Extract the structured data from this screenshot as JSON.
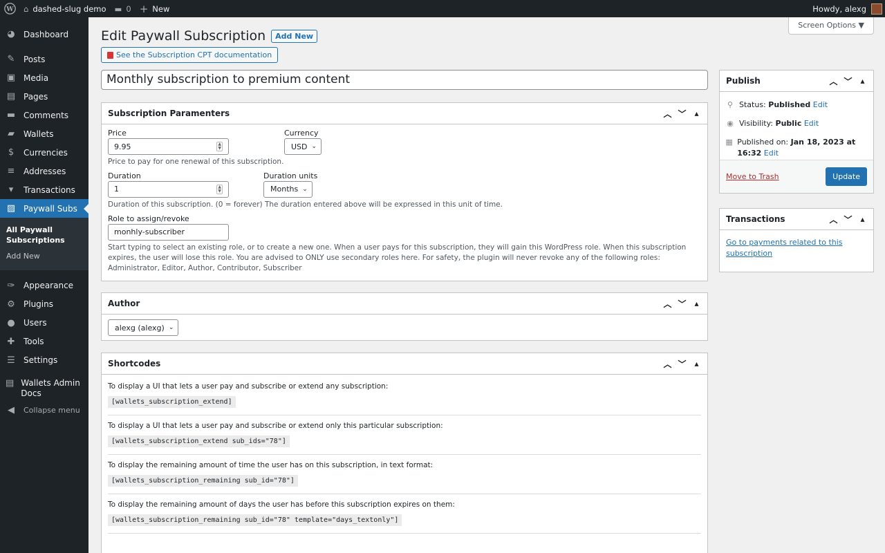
{
  "adminbar": {
    "site_name": "dashed-slug demo",
    "comments_count": "0",
    "new_label": "New",
    "howdy": "Howdy, alexg"
  },
  "sidebar": {
    "items_top": [
      {
        "label": "Dashboard",
        "icon": "dashboard-icon",
        "glyph": "◕"
      }
    ],
    "items_main": [
      {
        "label": "Posts",
        "icon": "pin-icon",
        "glyph": "✎"
      },
      {
        "label": "Media",
        "icon": "media-icon",
        "glyph": "▣"
      },
      {
        "label": "Pages",
        "icon": "page-icon",
        "glyph": "▤"
      },
      {
        "label": "Comments",
        "icon": "comment-icon",
        "glyph": "▬"
      },
      {
        "label": "Wallets",
        "icon": "wallet-icon",
        "glyph": "▰"
      },
      {
        "label": "Currencies",
        "icon": "currency-icon",
        "glyph": "$"
      },
      {
        "label": "Addresses",
        "icon": "addresses-icon",
        "glyph": "≡"
      },
      {
        "label": "Transactions",
        "icon": "transactions-icon",
        "glyph": "▾"
      }
    ],
    "current": {
      "label": "Paywall Subs",
      "icon": "paywall-icon",
      "glyph": "▨"
    },
    "submenu": [
      "All Paywall Subscriptions",
      "Add New"
    ],
    "items_bottom": [
      {
        "label": "Appearance",
        "icon": "appearance-icon",
        "glyph": "✑"
      },
      {
        "label": "Plugins",
        "icon": "plugin-icon",
        "glyph": "⚙"
      },
      {
        "label": "Users",
        "icon": "users-icon",
        "glyph": "●"
      },
      {
        "label": "Tools",
        "icon": "tools-icon",
        "glyph": "✚"
      },
      {
        "label": "Settings",
        "icon": "settings-icon",
        "glyph": "☰"
      }
    ],
    "wallets_docs": "Wallets Admin Docs",
    "collapse": "Collapse menu"
  },
  "header": {
    "screen_options": "Screen Options ▼",
    "title": "Edit Paywall Subscription",
    "add_new": "Add New",
    "doc_link": "See the Subscription CPT documentation"
  },
  "post_title": "Monthly subscription to premium content",
  "params": {
    "heading": "Subscription Paramenters",
    "price_label": "Price",
    "price_value": "9.95",
    "currency_label": "Currency",
    "currency_value": "USD",
    "price_desc": "Price to pay for one renewal of this subscription.",
    "duration_label": "Duration",
    "duration_value": "1",
    "duration_units_label": "Duration units",
    "duration_units_value": "Months",
    "duration_desc": "Duration of this subscription. (0 = forever) The duration entered above will be expressed in this unit of time.",
    "role_label": "Role to assign/revoke",
    "role_value": "monhly-subscriber",
    "role_desc": "Start typing to select an existing role, or to create a new one. When a user pays for this subscription, they will gain this WordPress role. When this subscription expires, the user will lose this role. You are advised to ONLY use secondary roles here. For safety, the plugin will never revoke any of the following roles: Administrator, Editor, Author, Contributor, Subscriber"
  },
  "author": {
    "heading": "Author",
    "value": "alexg (alexg)"
  },
  "shortcodes": {
    "heading": "Shortcodes",
    "items": [
      {
        "text": "To display a UI that lets a user pay and subscribe or extend any subscription:",
        "code": "[wallets_subscription_extend]"
      },
      {
        "text": "To display a UI that lets a user pay and subscribe or extend only this particular subscription:",
        "code": "[wallets_subscription_extend sub_ids=\"78\"]"
      },
      {
        "text": "To display the remaining amount of time the user has on this subscription, in text format:",
        "code": "[wallets_subscription_remaining sub_id=\"78\"]"
      },
      {
        "text": "To display the remaining amount of days the user has before this subscription expires on them:",
        "code": "[wallets_subscription_remaining sub_id=\"78\" template=\"days_textonly\"]"
      }
    ]
  },
  "publish": {
    "heading": "Publish",
    "status_label": "Status:",
    "status_value": "Published",
    "visibility_label": "Visibility:",
    "visibility_value": "Public",
    "published_label": "Published on:",
    "published_value": "Jan 18, 2023 at 16:32",
    "edit": "Edit",
    "trash": "Move to Trash",
    "update": "Update"
  },
  "transactions_box": {
    "heading": "Transactions",
    "link": "Go to payments related to this subscription"
  }
}
